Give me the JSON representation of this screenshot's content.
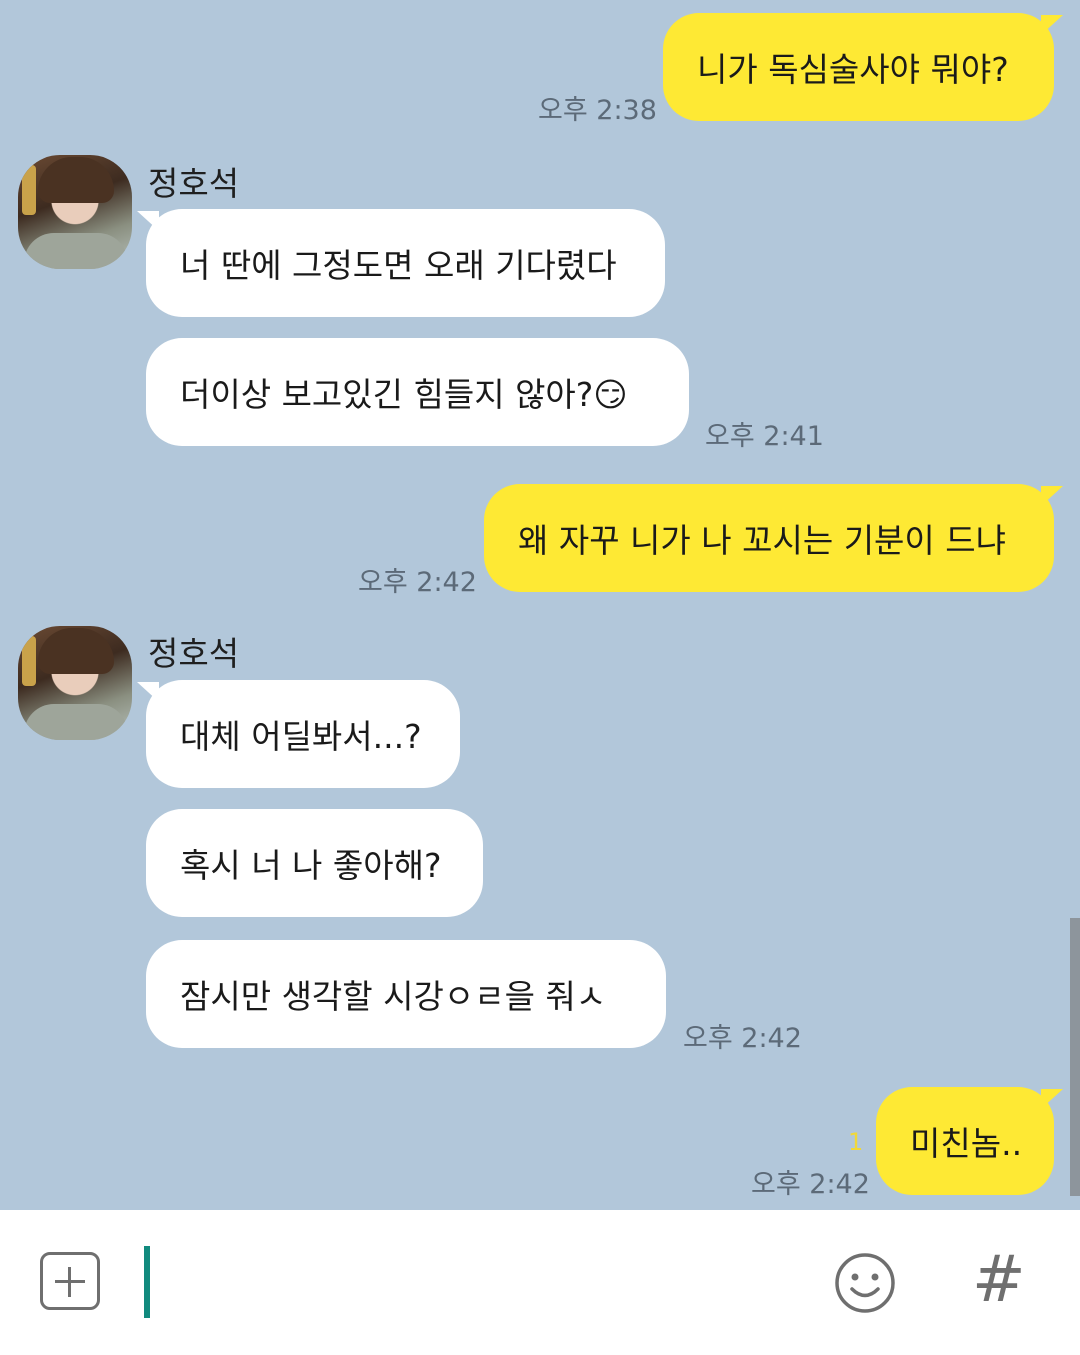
{
  "messages": [
    {
      "sender": "me",
      "text": "니가 독심술사야 뭐야?",
      "time": "오후 2:38"
    },
    {
      "sender": "정호석",
      "text": "너 딴에 그정도면 오래 기다렸다"
    },
    {
      "sender": "정호석",
      "text": "더이상 보고있긴 힘들지 않아?😏",
      "time": "오후 2:41"
    },
    {
      "sender": "me",
      "text": "왜 자꾸 니가 나 꼬시는 기분이 드냐",
      "time": "오후 2:42"
    },
    {
      "sender": "정호석",
      "text": "대체 어딜봐서...?"
    },
    {
      "sender": "정호석",
      "text": "혹시 너 나 좋아해?"
    },
    {
      "sender": "정호석",
      "text": "잠시만 생각할 시강ㅇㄹ을 줘ㅅ",
      "time": "오후 2:42"
    },
    {
      "sender": "me",
      "text": "미친놈..",
      "time": "오후 2:42",
      "unread": "1"
    }
  ],
  "contact": {
    "name": "정호석"
  },
  "input_bar": {
    "value": "",
    "hash_label": "#"
  },
  "colors": {
    "background": "#b2c7da",
    "my_bubble": "#fee934",
    "their_bubble": "#ffffff",
    "cursor": "#118a7e"
  },
  "icons": {
    "attach": "plus-square-icon",
    "emoji": "smiley-icon",
    "hashtag": "hash-icon"
  }
}
